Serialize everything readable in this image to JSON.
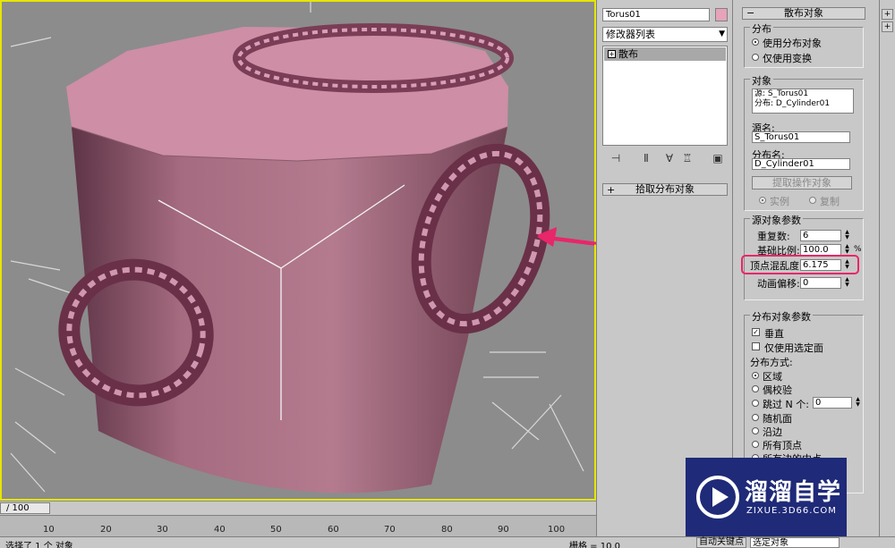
{
  "viewport": {
    "label": "Perspective viewport"
  },
  "modify_panel": {
    "object_name": "Torus01",
    "modifier_list_label": "修改器列表",
    "stack_item": "散布",
    "pick_rollout_label": "拾取分布对象"
  },
  "scatter": {
    "rollout_title": "散布对象",
    "distribution": {
      "title": "分布",
      "use_distribution_object": "使用分布对象",
      "use_transforms_only": "仅使用变换"
    },
    "objects": {
      "title": "对象",
      "source_line": "源: S_Torus01",
      "dist_line": "分布: D_Cylinder01",
      "source_name_label": "源名:",
      "source_name_value": "S_Torus01",
      "dist_name_label": "分布名:",
      "dist_name_value": "D_Cylinder01",
      "extract_button": "提取操作对象",
      "instance_label": "实例",
      "copy_label": "复制"
    },
    "source_params": {
      "title": "源对象参数",
      "duplicates_label": "重复数:",
      "duplicates_value": "6",
      "base_scale_label": "基础比例:",
      "base_scale_value": "100.0",
      "vertex_chaos_label": "顶点混乱度:",
      "vertex_chaos_value": "6.175",
      "anim_offset_label": "动画偏移:",
      "anim_offset_value": "0"
    },
    "dist_params": {
      "title": "分布对象参数",
      "perpendicular_label": "垂直",
      "selected_faces_label": "仅使用选定面",
      "method_label": "分布方式:",
      "area_label": "区域",
      "even_label": "偶校验",
      "skip_label": "跳过 N 个:",
      "skip_value": "0",
      "random_faces_label": "随机面",
      "along_edges_label": "沿边",
      "all_vertices_label": "所有顶点",
      "edge_midpoints_label": "所有边的中点"
    }
  },
  "timeline": {
    "frame_label": "/ 100",
    "ticks": [
      "10",
      "20",
      "30",
      "40",
      "50",
      "60",
      "70",
      "80",
      "90",
      "100"
    ]
  },
  "status": {
    "selected_text": "选择了 1 个 对象",
    "grid_text": "栅格 = 10.0",
    "auto_key": "自动关键点",
    "selected_dropdown": "选定对象"
  },
  "watermark": {
    "brand": "溜溜自学",
    "url": "ZIXUE.3D66.COM"
  },
  "colors": {
    "object_pink": "#e6a3bb",
    "viewport_border": "#e6e600",
    "highlight_red": "#e8266a",
    "watermark_bg": "#1f2a78"
  }
}
